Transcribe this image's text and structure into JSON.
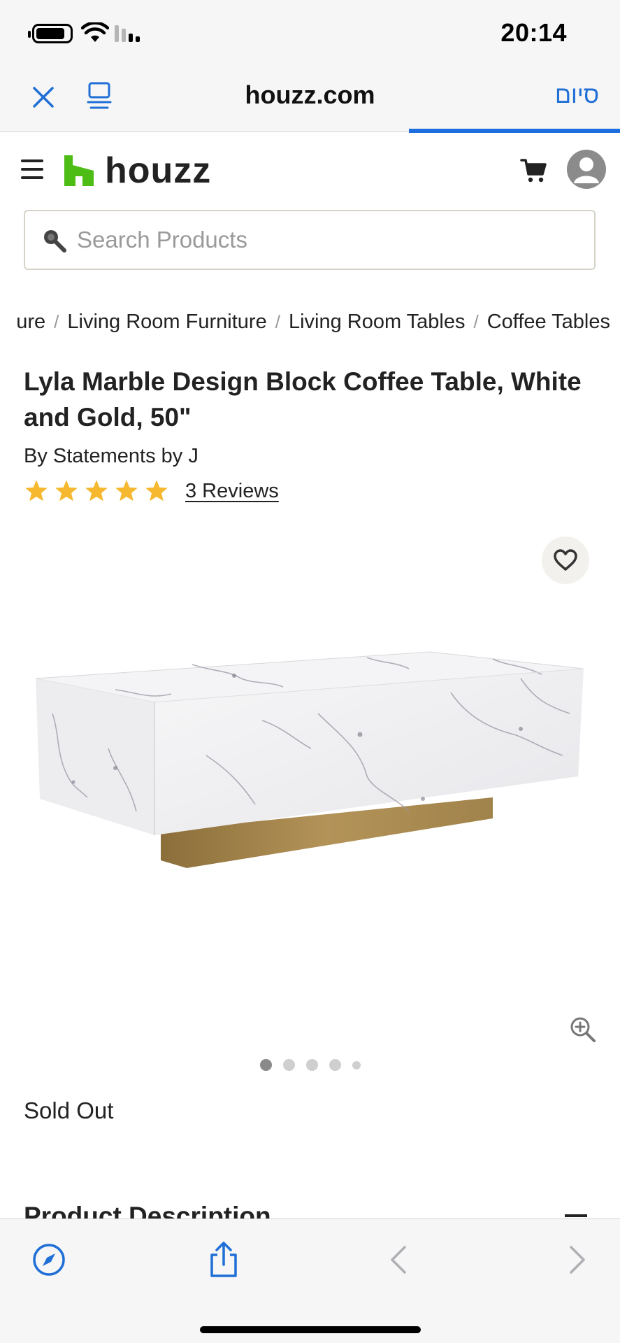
{
  "status_bar": {
    "time": "20:14",
    "icons": [
      "battery-icon",
      "wifi-icon",
      "cellular-signal-icon"
    ]
  },
  "browser": {
    "url": "houzz.com",
    "done_label": "סיום",
    "close_icon": "close-icon",
    "reader_icon": "reader-mode-icon",
    "accent_color": "#1d6fe0"
  },
  "header": {
    "logo_text": "houzz",
    "logo_color": "#4dbc15",
    "menu_icon": "hamburger-menu-icon",
    "cart_icon": "cart-icon",
    "account_icon": "account-avatar-icon"
  },
  "search": {
    "placeholder": "Search Products",
    "value": ""
  },
  "breadcrumb": {
    "items": [
      "ure",
      "Living Room Furniture",
      "Living Room Tables",
      "Coffee Tables"
    ],
    "separator": "/"
  },
  "product": {
    "title": "Lyla Marble Design Block Coffee Table, White and Gold, 50\"",
    "brand": "By Statements by J",
    "rating": 5,
    "star_color": "#f5b82e",
    "reviews_label": "3 Reviews",
    "availability": "Sold Out",
    "image_count": 5,
    "active_image": 1
  },
  "sections": {
    "description_title": "Product Description"
  },
  "bottom_bar": {
    "icons": [
      "compass-icon",
      "share-icon",
      "back-arrow-icon",
      "forward-arrow-icon"
    ]
  }
}
